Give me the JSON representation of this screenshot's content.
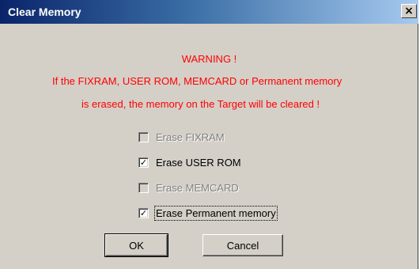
{
  "window": {
    "title": "Clear Memory",
    "close_glyph": "×",
    "close_icon": "close-icon"
  },
  "warning": {
    "line1": "WARNING !",
    "line2": "If the FIXRAM, USER ROM, MEMCARD or Permanent memory",
    "line3": "is erased, the memory on the Target will be cleared !",
    "color": "#ff0000"
  },
  "options": [
    {
      "label": "Erase FIXRAM",
      "checked": false,
      "enabled": false
    },
    {
      "label": "Erase USER ROM",
      "checked": true,
      "enabled": true
    },
    {
      "label": "Erase MEMCARD",
      "checked": false,
      "enabled": false
    },
    {
      "label": "Erase Permanent memory",
      "checked": true,
      "enabled": true,
      "focused": true
    }
  ],
  "buttons": {
    "ok": "OK",
    "cancel": "Cancel"
  }
}
